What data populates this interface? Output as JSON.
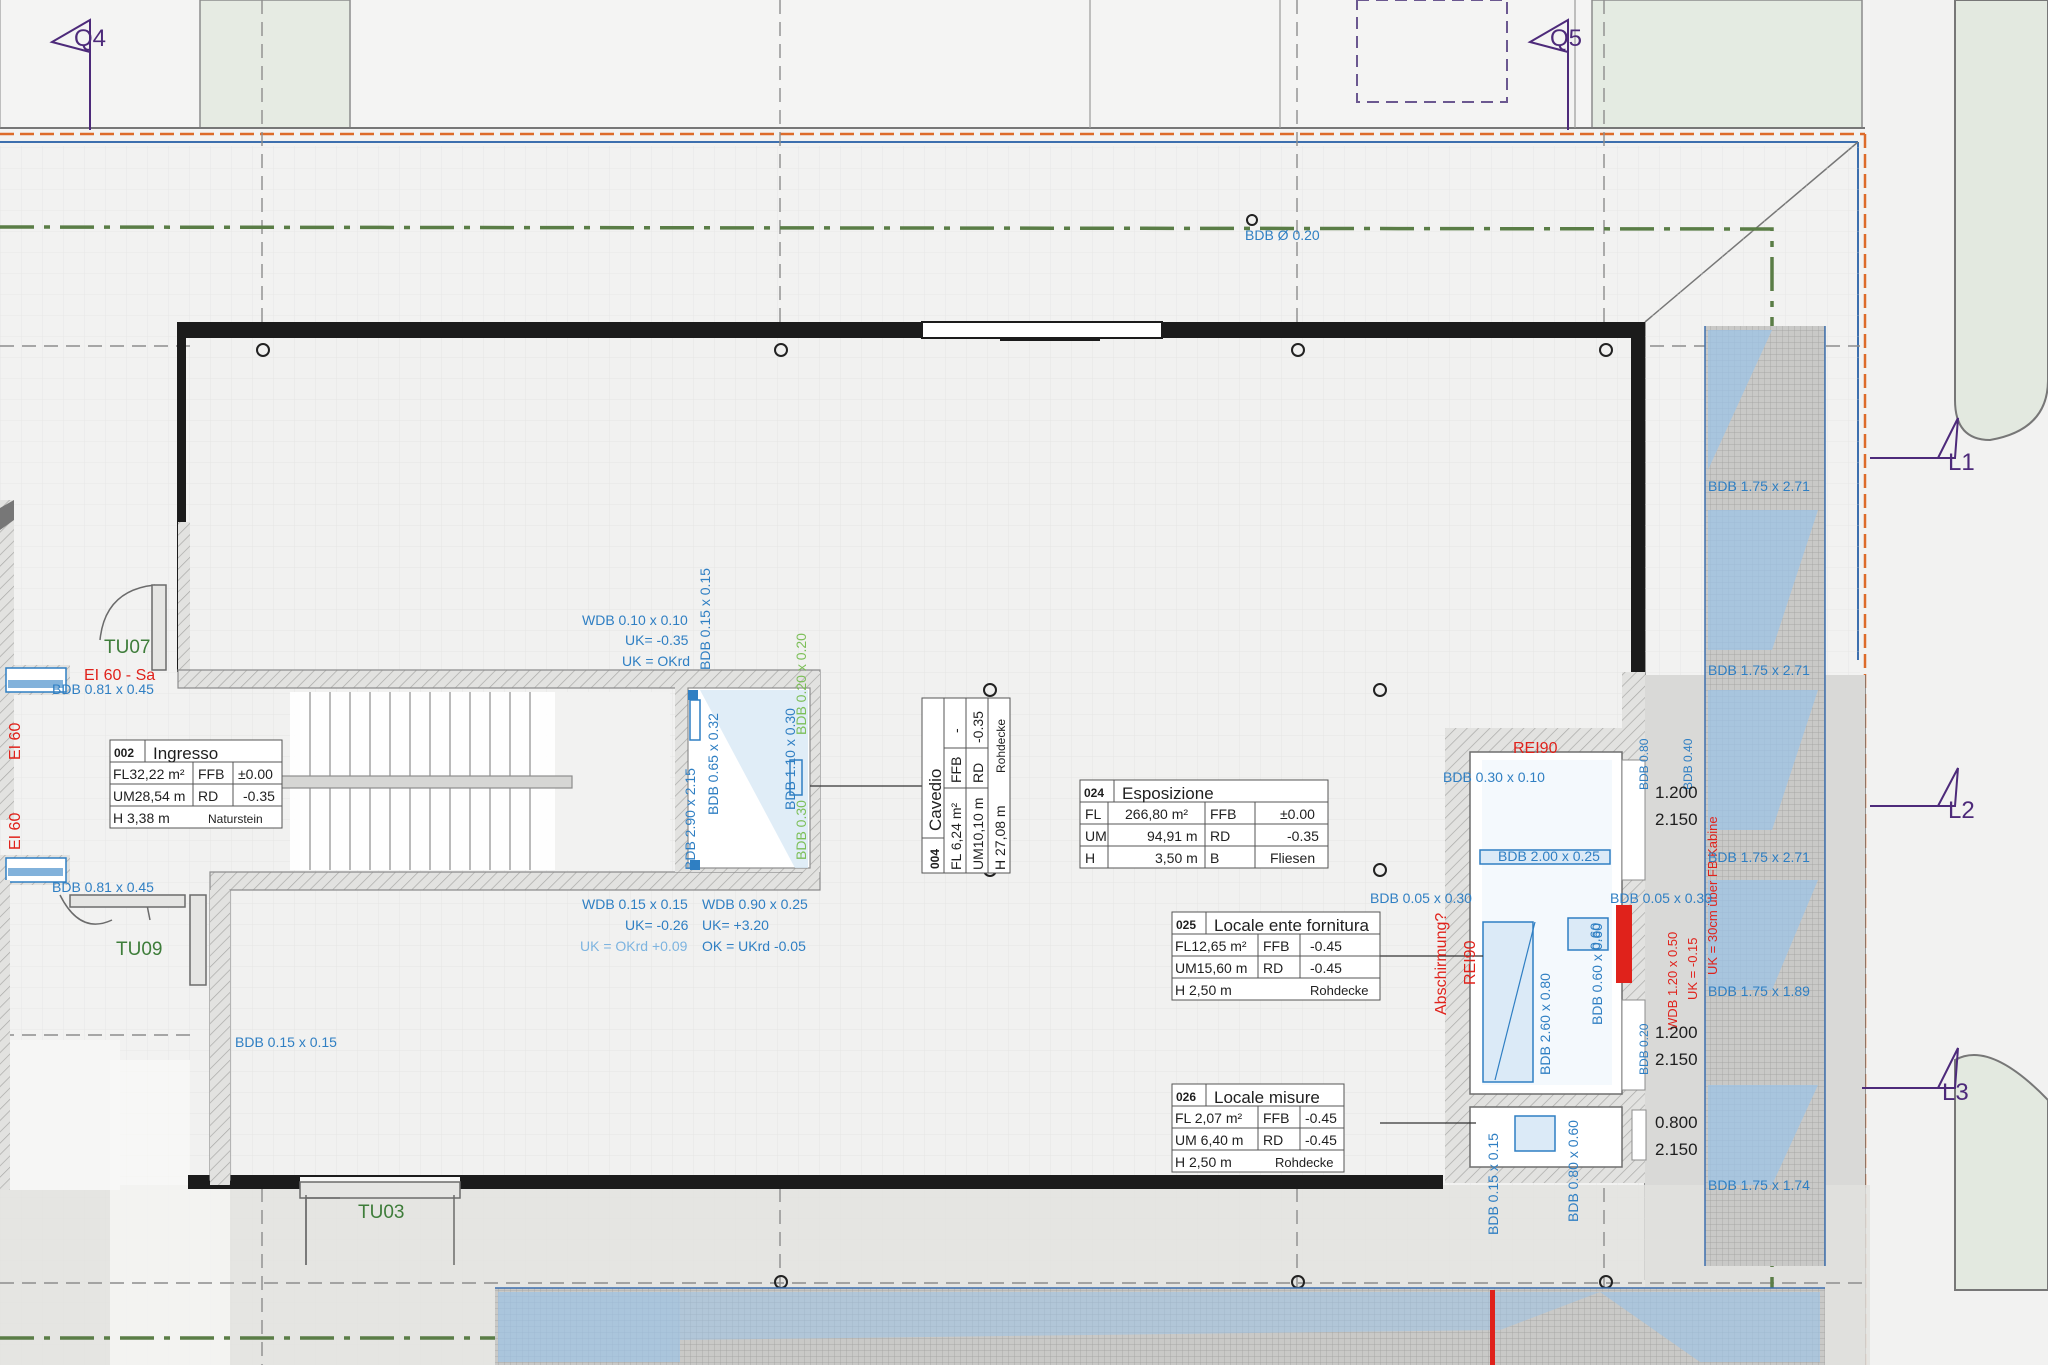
{
  "colors": {
    "background": "#f4f4f3",
    "wall": "#1b1b1b",
    "hatch": "#c8c8c6",
    "axis_green": "#5a7d46",
    "accent_blue": "#2f7fc3",
    "glass_blue": "#9cc3e6",
    "red": "#e0221b",
    "purple": "#4d2a7a",
    "room_label": "#1f1f1f",
    "door_label": "#3e7d3a"
  },
  "section_markers": [
    {
      "id": "Q4",
      "label": "Q4"
    },
    {
      "id": "Q5",
      "label": "Q5"
    },
    {
      "id": "L1",
      "label": "L1"
    },
    {
      "id": "L2",
      "label": "L2"
    },
    {
      "id": "L3",
      "label": "L3"
    }
  ],
  "doors": {
    "TU07": "TU07",
    "TU09": "TU09",
    "TU03": "TU03"
  },
  "fire_labels": {
    "ei60_sa": "EI 60 - Sa",
    "ei60_a": "EI 60",
    "ei60_b": "EI 60",
    "rei90_top": "REI90",
    "rei90_mid": "REI90",
    "abschirmung": "Abschirmung?",
    "wdb_red": "WDB 1.20 x 0.50",
    "uk_red": "UK = -0.15",
    "uk30_red": "UK = 30cm über FB Kabine"
  },
  "annotations": {
    "bdb_top": "BDB Ø 0.20",
    "bdb_081_a": "BDB 0.81 x 0.45",
    "bdb_081_b": "BDB 0.81 x 0.45",
    "bdb_015_015": "BDB 0.15 x 0.15",
    "wdb_010": "WDB 0.10 x 0.10",
    "uk_035": "UK= -0.35",
    "uk_okrd": "UK = OKrd",
    "bdb_015_vert": "BDB 0.15 x 0.15",
    "bdb_020_green": "BDB 0.20 x 0.20",
    "bdb_065": "BDB 0.65 x 0.32",
    "bdb_290": "BDB 2.90 x 2.15",
    "bdb_110": "BDB 1.10 x 0.30",
    "bdb_030_green": "BDB 0.30",
    "wdb_015": "WDB 0.15 x 0.15",
    "uk_026": "UK= -0.26",
    "uk_okrd_009": "UK = OKrd +0.09",
    "wdb_090": "WDB 0.90 x 0.25",
    "uk_320": "UK= +3.20",
    "ok_ukrd": "OK = UKrd -0.05",
    "bdb_030_010": "BDB 0.30 x 0.10",
    "bdb_200_025": "BDB 2.00 x 0.25",
    "bdb_005_030_a": "BDB 0.05 x 0.30",
    "bdb_005_030_b": "BDB 0.05 x 0.30",
    "bdb_260": "BDB 2.60 x 0.80",
    "bdb_060_060": "BDB 0.60 x 0.60",
    "bdb_060_small": "0.60",
    "bdb_015_bottom": "BDB 0.15 x 0.15",
    "bdb_080_060": "BDB 0.80 x 0.60",
    "bdb_080": "BDB 0.80",
    "bdb_040": "BDB 0.40",
    "bdb_020_shaft": "BDB 0.20",
    "bdb_shaft_a": "BDB 1.75 x 2.71",
    "bdb_shaft_b": "BDB 1.75 x 2.71",
    "bdb_shaft_c": "BDB 1.75 x 2.71",
    "bdb_shaft_d": "BDB 1.75 x 1.89",
    "bdb_shaft_e": "BDB 1.75 x 1.74",
    "door_dim_a1": "1.200",
    "door_dim_a2": "2.150",
    "door_dim_b1": "1.200",
    "door_dim_b2": "2.150",
    "door_dim_c1": "0.800",
    "door_dim_c2": "2.150"
  },
  "rooms": {
    "ingresso": {
      "number": "002",
      "name": "Ingresso",
      "r1": [
        "FL32,22 m²",
        "FFB",
        "±0.00"
      ],
      "r2": [
        "UM28,54 m",
        "RD",
        "-0.35"
      ],
      "r3": [
        "H   3,38 m",
        "Naturstein"
      ]
    },
    "cavedio": {
      "number": "004",
      "name": "Cavedio",
      "r1": [
        "FL   6,24 m²",
        "FFB",
        "-"
      ],
      "r2": [
        "UM10,10 m",
        "RD",
        "-0.35"
      ],
      "r3": [
        "H   27,08 m",
        "Rohdecke"
      ]
    },
    "esposizione": {
      "number": "024",
      "name": "Esposizione",
      "r1": [
        "FL",
        "266,80 m²",
        "FFB",
        "±0.00"
      ],
      "r2": [
        "UM",
        "94,91 m",
        "RD",
        "-0.35"
      ],
      "r3": [
        "H",
        "3,50 m",
        "B",
        "Fliesen"
      ]
    },
    "ente": {
      "number": "025",
      "name": "Locale ente fornitura",
      "r1": [
        "FL12,65 m²",
        "FFB",
        "-0.45"
      ],
      "r2": [
        "UM15,60 m",
        "RD",
        "-0.45"
      ],
      "r3": [
        "H   2,50 m",
        "Rohdecke"
      ]
    },
    "misure": {
      "number": "026",
      "name": "Locale misure",
      "r1": [
        "FL  2,07 m²",
        "FFB",
        "-0.45"
      ],
      "r2": [
        "UM  6,40 m",
        "RD",
        "-0.45"
      ],
      "r3": [
        "H   2,50 m",
        "Rohdecke"
      ]
    }
  }
}
